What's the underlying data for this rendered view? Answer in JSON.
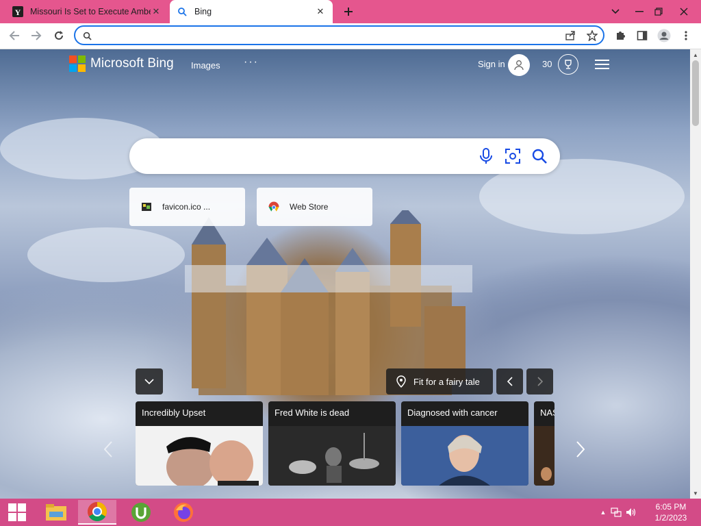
{
  "browser": {
    "tabs": [
      {
        "title": "Missouri Is Set to Execute Amber",
        "active": false,
        "favicon": "yahoo-y-icon"
      },
      {
        "title": "Bing",
        "active": true,
        "favicon": "search-icon"
      }
    ],
    "address_value": "",
    "accent": "#e5568e"
  },
  "bing": {
    "brand": "Microsoft Bing",
    "nav": {
      "images": "Images",
      "more": "···"
    },
    "sign_in": "Sign in",
    "points": "30",
    "search_value": "",
    "quicklinks": [
      {
        "label": "favicon.ico ...",
        "icon": "favicon-icon"
      },
      {
        "label": "Web Store",
        "icon": "chrome-web-store-icon"
      }
    ],
    "location": "Fit for a fairy tale",
    "news": [
      {
        "headline": "Incredibly Upset"
      },
      {
        "headline": "Fred White is dead"
      },
      {
        "headline": "Diagnosed with cancer"
      },
      {
        "headline": "NAS"
      }
    ]
  },
  "taskbar": {
    "time": "6:05 PM",
    "date": "1/2/2023",
    "color": "#d34b87",
    "apps": [
      "file-explorer-icon",
      "chrome-icon",
      "utorrent-icon",
      "firefox-icon"
    ]
  }
}
